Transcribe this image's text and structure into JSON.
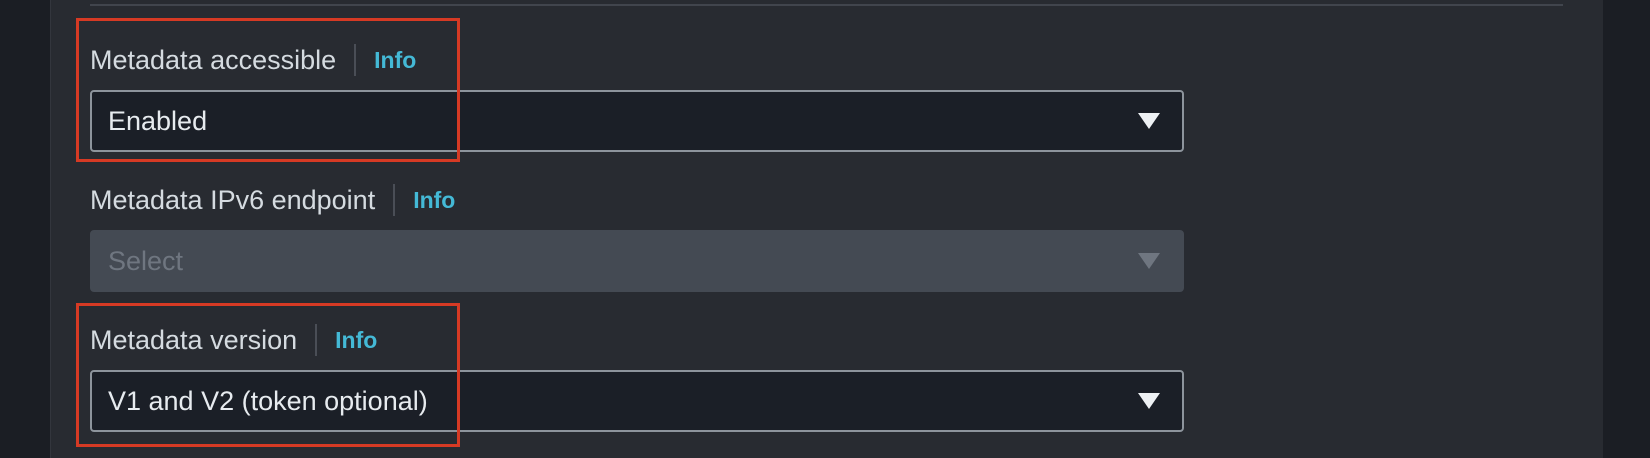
{
  "fields": [
    {
      "label": "Metadata accessible",
      "info": "Info",
      "value": "Enabled",
      "disabled": false
    },
    {
      "label": "Metadata IPv6 endpoint",
      "info": "Info",
      "placeholder": "Select",
      "disabled": true
    },
    {
      "label": "Metadata version",
      "info": "Info",
      "value": "V1 and V2 (token optional)",
      "disabled": false
    }
  ],
  "colors": {
    "highlight": "#d63a24",
    "info_link": "#44b9d6",
    "panel_bg": "#282b31"
  },
  "icons": {
    "dropdown": "caret-down-icon"
  }
}
